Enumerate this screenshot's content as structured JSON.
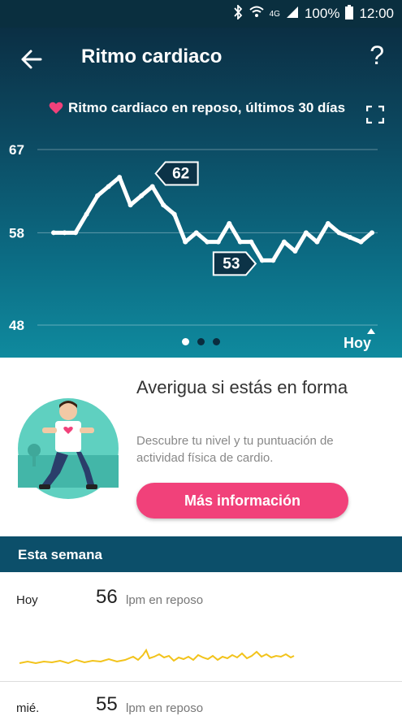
{
  "status_bar": {
    "battery": "100%",
    "time": "12:00",
    "network": "4G"
  },
  "header": {
    "title": "Ritmo cardiaco",
    "help": "?",
    "subtitle": "Ritmo cardiaco en reposo, últimos 30 días"
  },
  "chart_data": {
    "type": "line",
    "ylim": [
      48,
      67
    ],
    "yticks": [
      "67",
      "58",
      "48"
    ],
    "x_label_end": "Hoy",
    "values": [
      58,
      58,
      58,
      60,
      62,
      63,
      64,
      61,
      62,
      63,
      61,
      60,
      57,
      58,
      57,
      57,
      59,
      57,
      57,
      55,
      55,
      57,
      56,
      58,
      57,
      59,
      58,
      57.5,
      57,
      58
    ],
    "callouts": [
      {
        "label": "62",
        "index": 9
      },
      {
        "label": "53",
        "index": 19
      }
    ]
  },
  "pager": {
    "pages": 3,
    "active": 0
  },
  "promo": {
    "title": "Averigua si estás en forma",
    "description": "Descubre tu nivel y tu puntuación de actividad física de cardio.",
    "button": "Más información"
  },
  "week": {
    "header": "Esta semana",
    "days": [
      {
        "label": "Hoy",
        "value": "56",
        "unit": "lpm en reposo"
      },
      {
        "label": "mié.",
        "value": "55",
        "unit": "lpm en reposo"
      }
    ]
  },
  "colors": {
    "accent": "#f1417a",
    "sparkline": "#f2c31b",
    "header_dark": "#0b2f44"
  }
}
